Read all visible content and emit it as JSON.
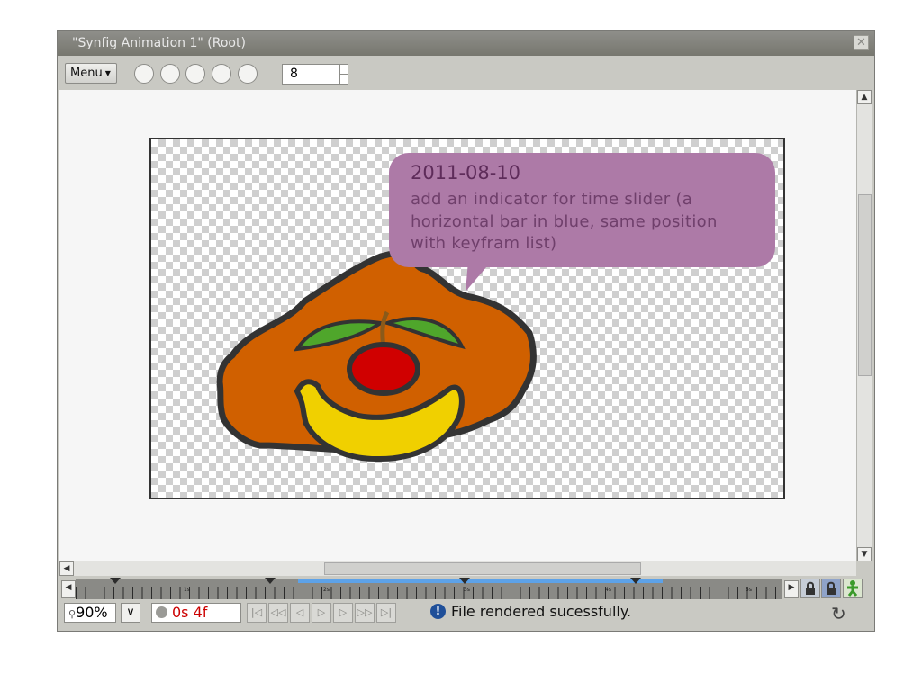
{
  "window": {
    "title": "\"Synfig Animation 1\" (Root)",
    "close_glyph": "✕"
  },
  "toolbar": {
    "menu_label": "Menu",
    "menu_caret": "▼",
    "spin_value": "8"
  },
  "note": {
    "date": "2011-08-10",
    "text": "add an indicator for time slider (a horizontal bar in blue, same position with keyfram list)"
  },
  "timeline": {
    "markers": [
      "1s",
      "2s",
      "3s",
      "4s",
      "5s"
    ],
    "indicator_color": "#5da2e8"
  },
  "status": {
    "zoom": "90%",
    "zoom_icon": "magnifier-icon",
    "current_time": "0s 4f",
    "message": "File rendered sucessfully.",
    "info_glyph": "!"
  },
  "colors": {
    "pumpkin": "#d06000",
    "banana": "#f0d000",
    "cherry": "#d00000",
    "leaf": "#4fa62b",
    "bubble": "#ad7aa7"
  }
}
